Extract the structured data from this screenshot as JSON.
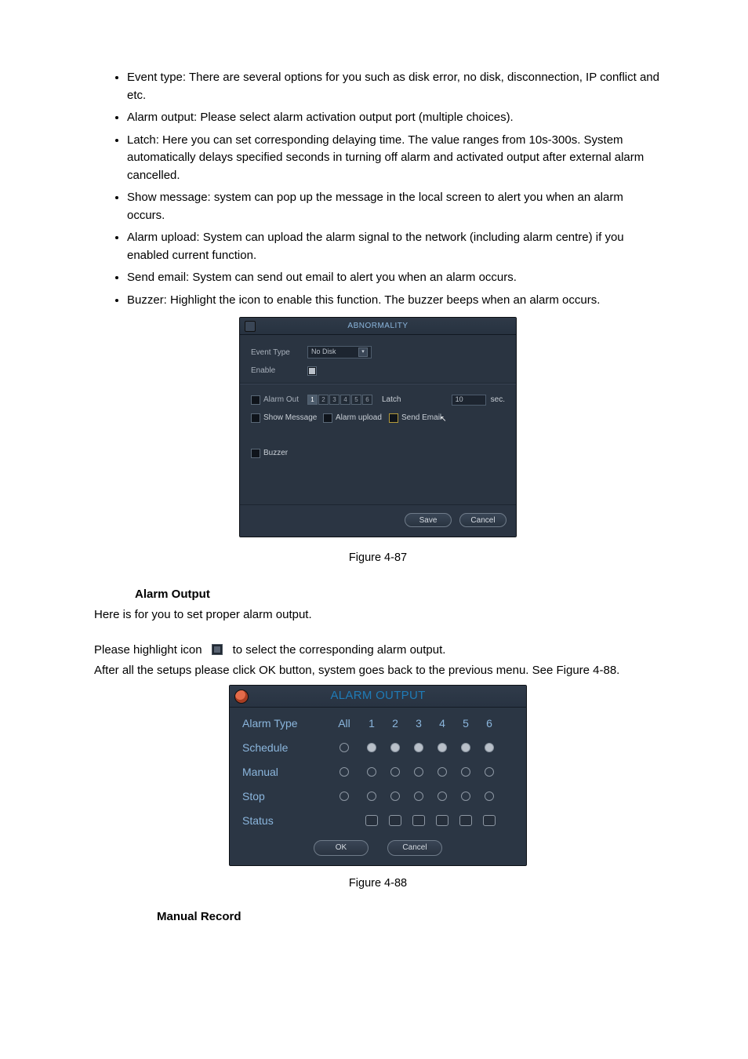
{
  "bullets": {
    "b0": "Event type: There are several options for you such as disk error, no disk, disconnection, IP conflict and etc.",
    "b1": "Alarm output: Please select alarm activation output port (multiple choices).",
    "b2": "Latch: Here you can set corresponding delaying time. The value ranges from 10s-300s. System automatically delays specified seconds in turning off alarm and activated output after external alarm cancelled.",
    "b3": "Show message: system can pop up the message in the local screen to alert you when an alarm occurs.",
    "b4": "Alarm upload: System can upload the alarm signal to the network (including alarm centre) if you enabled current function.",
    "b5": "Send email: System can send out email to alert you when an alarm occurs.",
    "b6": "Buzzer: Highlight the icon to enable this function. The buzzer beeps when an alarm occurs."
  },
  "abnormality": {
    "title": "ABNORMALITY",
    "event_type_label": "Event Type",
    "event_type_value": "No Disk",
    "enable_label": "Enable",
    "alarm_out_label": "Alarm Out",
    "channels": [
      "1",
      "2",
      "3",
      "4",
      "5",
      "6"
    ],
    "latch_label": "Latch",
    "latch_value": "10",
    "latch_unit": "sec.",
    "show_message_label": "Show Message",
    "alarm_upload_label": "Alarm upload",
    "send_email_label": "Send Email",
    "buzzer_label": "Buzzer",
    "save": "Save",
    "cancel": "Cancel"
  },
  "fig1": "Figure 4-87",
  "sectionA": "Alarm Output",
  "textA1": "Here is for you to set proper alarm output.",
  "textA2a": "Please highlight icon",
  "textA2b": "to select the corresponding alarm output.",
  "textA3": "After all the setups please click OK button, system goes back to the previous menu. See Figure 4-88.",
  "alarm_output": {
    "title": "ALARM OUTPUT",
    "row_alarm_type": "Alarm Type",
    "col_all": "All",
    "cols": [
      "1",
      "2",
      "3",
      "4",
      "5",
      "6"
    ],
    "row_schedule": "Schedule",
    "row_manual": "Manual",
    "row_stop": "Stop",
    "row_status": "Status",
    "ok": "OK",
    "cancel": "Cancel"
  },
  "fig2": "Figure 4-88",
  "sectionB": "Manual Record"
}
